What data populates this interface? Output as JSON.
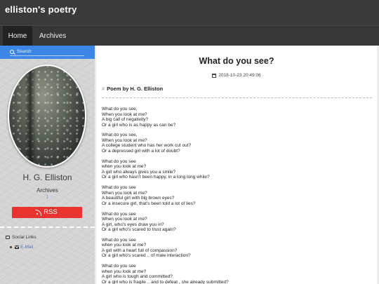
{
  "site": {
    "title": "elliston's poetry"
  },
  "nav": {
    "items": [
      "Home",
      "Archives"
    ],
    "active": "Home"
  },
  "sidebar": {
    "search_placeholder": "Search",
    "author": "H. G. Elliston",
    "archives_label": "Archives",
    "archives_count": "1",
    "rss_label": "RSS",
    "social_title": "Social Links",
    "social_links": [
      "E-Mail"
    ]
  },
  "post": {
    "title": "What do you see?",
    "date": "2018-10-23 20:49:06",
    "heading_hash": "#",
    "heading": "Poem by H. G. Elliston",
    "stanzas": [
      [
        "What do you see,",
        "When you look at me?",
        "A big call of negativity?",
        "Or a girl who is as happy as can be?"
      ],
      [
        "What do you see,",
        "When you look at me?",
        "A college student who has her work cut out?",
        "Or a depressed girl with a lot of doubt?"
      ],
      [
        "What do you see",
        "when you look at me?",
        "A girl who always gives you a smile?",
        "Or a girl who hasn't been happy, in a long long while?"
      ],
      [
        "What do you see",
        "When you look at me?",
        "A beautiful girl with big brown eyes?",
        "Or a insecure girl, that's been told a lot of lies?"
      ],
      [
        "What do you see",
        "When you look at me?",
        "A girl, who's eyes draw you in?",
        "Or a girl who's scared to trust again?"
      ],
      [
        "What do you see",
        "when you look at me?",
        "A girl with a heart full of compassion?",
        "Or a girl who's scared .. of male interaction?"
      ],
      [
        "What do you see",
        "when you look at me?",
        "A girl who is tough and committed?",
        "Or a girl who is fragile .. and to defeat , she already submitted?"
      ]
    ]
  },
  "colors": {
    "topbar": "#3a3a3a",
    "navbar": "#363636",
    "search_bar": "#3c87e6",
    "rss": "#e8332e",
    "link": "#4a72b8"
  }
}
